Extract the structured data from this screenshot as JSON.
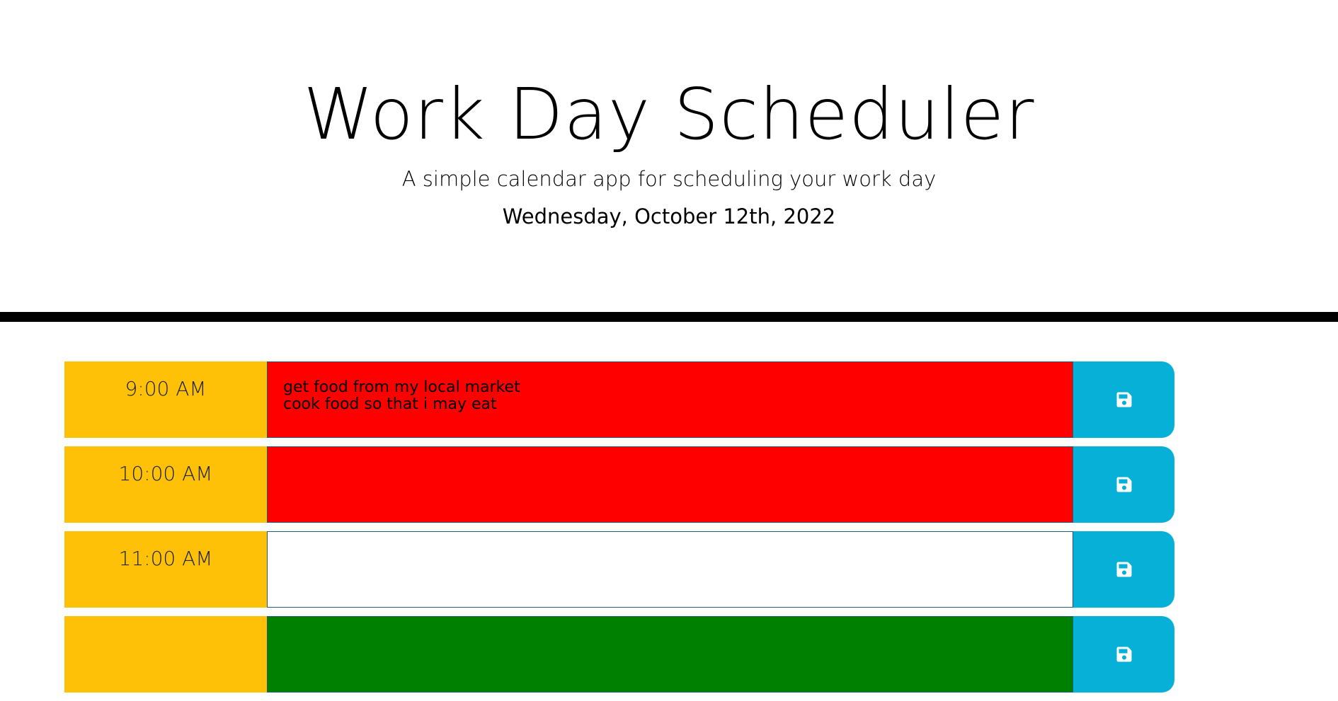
{
  "header": {
    "title": "Work Day Scheduler",
    "subtitle": "A simple calendar app for scheduling your work day",
    "current_day": "Wednesday, October 12th, 2022"
  },
  "colors": {
    "hour_bg": "#ffc107",
    "past": "#ff0000",
    "present": "#ffffff",
    "future": "#008000",
    "save_bg": "#06b0d6",
    "save_icon": "#ffffff",
    "divider": "#000000"
  },
  "time_blocks": [
    {
      "hour": "9:00 AM",
      "description": "get food from my local market\ncook food so that i may eat",
      "state": "past",
      "save_icon": "floppy-disk-icon"
    },
    {
      "hour": "10:00 AM",
      "description": "",
      "state": "past",
      "save_icon": "floppy-disk-icon"
    },
    {
      "hour": "11:00 AM",
      "description": "",
      "state": "present",
      "save_icon": "floppy-disk-icon"
    },
    {
      "hour": "",
      "description": "",
      "state": "future",
      "save_icon": "floppy-disk-icon"
    }
  ]
}
